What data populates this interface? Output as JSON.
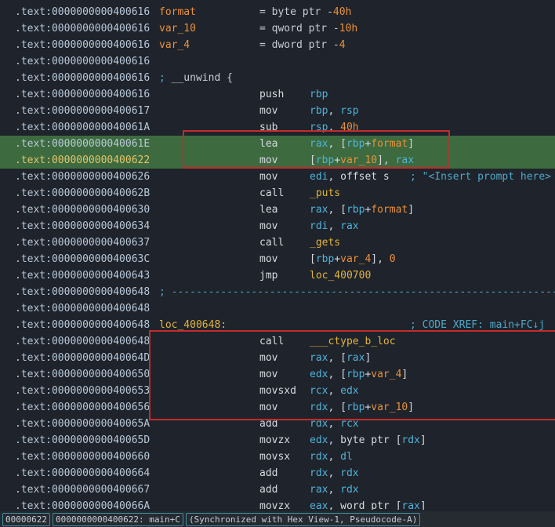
{
  "listing": [
    {
      "addr": ".text:0000000000400616",
      "kind": "var",
      "label": "format",
      "text": "= byte ptr -40h"
    },
    {
      "addr": ".text:0000000000400616",
      "kind": "var",
      "label": "var_10",
      "text": "= qword ptr -10h"
    },
    {
      "addr": ".text:0000000000400616",
      "kind": "var",
      "label": "var_4",
      "text": "= dword ptr -4"
    },
    {
      "addr": ".text:0000000000400616",
      "kind": "blank"
    },
    {
      "addr": ".text:0000000000400616",
      "kind": "unwind",
      "text": "; __unwind {"
    },
    {
      "addr": ".text:0000000000400616",
      "kind": "ins",
      "mnem": "push",
      "ops": "rbp"
    },
    {
      "addr": ".text:0000000000400617",
      "kind": "ins",
      "mnem": "mov",
      "ops": "rbp, rsp"
    },
    {
      "addr": ".text:000000000040061A",
      "kind": "ins",
      "mnem": "sub",
      "ops": "rsp, 40h"
    },
    {
      "addr": ".text:000000000040061E",
      "kind": "ins",
      "mnem": "lea",
      "ops": "rax, [rbp+format]",
      "hl": true
    },
    {
      "addr": ".text:0000000000400622",
      "kind": "ins",
      "mnem": "mov",
      "ops": "[rbp+var_10], rax",
      "hl": true,
      "sel": true
    },
    {
      "addr": ".text:0000000000400626",
      "kind": "ins",
      "mnem": "mov",
      "ops": "edi, offset s",
      "comment": "; \"<Insert prompt here>"
    },
    {
      "addr": ".text:000000000040062B",
      "kind": "ins",
      "mnem": "call",
      "ops": "_puts"
    },
    {
      "addr": ".text:0000000000400630",
      "kind": "ins",
      "mnem": "lea",
      "ops": "rax, [rbp+format]"
    },
    {
      "addr": ".text:0000000000400634",
      "kind": "ins",
      "mnem": "mov",
      "ops": "rdi, rax"
    },
    {
      "addr": ".text:0000000000400637",
      "kind": "ins",
      "mnem": "call",
      "ops": "_gets"
    },
    {
      "addr": ".text:000000000040063C",
      "kind": "ins",
      "mnem": "mov",
      "ops": "[rbp+var_4], 0"
    },
    {
      "addr": ".text:0000000000400643",
      "kind": "ins",
      "mnem": "jmp",
      "ops": "loc_400700"
    },
    {
      "addr": ".text:0000000000400648",
      "kind": "sep",
      "text": "; -----------------------------------------------------------------------"
    },
    {
      "addr": ".text:0000000000400648",
      "kind": "blank"
    },
    {
      "addr": ".text:0000000000400648",
      "kind": "loc",
      "label": "loc_400648:",
      "comment": "; CODE XREF: main+FC↓j"
    },
    {
      "addr": ".text:0000000000400648",
      "kind": "ins",
      "mnem": "call",
      "ops": "___ctype_b_loc"
    },
    {
      "addr": ".text:000000000040064D",
      "kind": "ins",
      "mnem": "mov",
      "ops": "rax, [rax]"
    },
    {
      "addr": ".text:0000000000400650",
      "kind": "ins",
      "mnem": "mov",
      "ops": "edx, [rbp+var_4]"
    },
    {
      "addr": ".text:0000000000400653",
      "kind": "ins",
      "mnem": "movsxd",
      "ops": "rcx, edx"
    },
    {
      "addr": ".text:0000000000400656",
      "kind": "ins",
      "mnem": "mov",
      "ops": "rdx, [rbp+var_10]"
    },
    {
      "addr": ".text:000000000040065A",
      "kind": "ins",
      "mnem": "add",
      "ops": "rdx, rcx"
    },
    {
      "addr": ".text:000000000040065D",
      "kind": "ins",
      "mnem": "movzx",
      "ops": "edx, byte ptr [rdx]"
    },
    {
      "addr": ".text:0000000000400660",
      "kind": "ins",
      "mnem": "movsx",
      "ops": "rdx, dl"
    },
    {
      "addr": ".text:0000000000400664",
      "kind": "ins",
      "mnem": "add",
      "ops": "rdx, rdx"
    },
    {
      "addr": ".text:0000000000400667",
      "kind": "ins",
      "mnem": "add",
      "ops": "rax, rdx"
    },
    {
      "addr": ".text:000000000040066A",
      "kind": "ins",
      "mnem": "movzx",
      "ops": "eax, word ptr [rax]"
    }
  ],
  "status": {
    "offset": "00000622",
    "location": "0000000000400622: main+C",
    "sync": "(Synchronized with Hex View-1, Pseudocode-A)"
  },
  "colors": {
    "background": "#1f232b",
    "highlight": "#3d6b3f",
    "annotation_box": "#c42b2b"
  }
}
